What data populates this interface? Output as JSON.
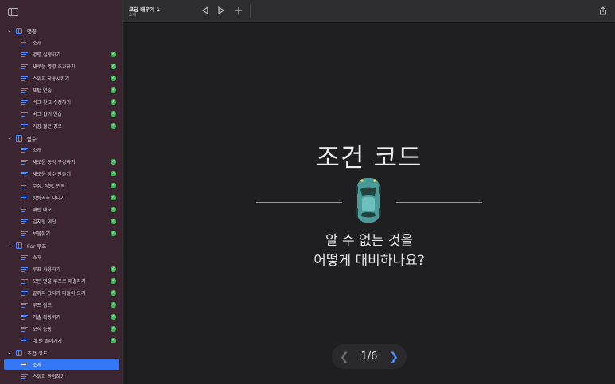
{
  "window": {
    "title": "코딩 배우기 1",
    "subtitle": "소개"
  },
  "toolbar": {
    "buttons": [
      {
        "name": "back-button",
        "icon": "triangle-left-icon"
      },
      {
        "name": "play-button",
        "icon": "triangle-right-icon"
      },
      {
        "name": "add-button",
        "icon": "plus-icon"
      },
      {
        "name": "share-button",
        "icon": "share-icon"
      }
    ]
  },
  "sidebar": {
    "chapters": [
      {
        "title": "명령",
        "pages": [
          {
            "label": "소개",
            "done": false
          },
          {
            "label": "명령 실행하기",
            "done": true
          },
          {
            "label": "새로운 명령 추가하기",
            "done": true
          },
          {
            "label": "스위치 작동시키기",
            "done": true
          },
          {
            "label": "포털 연습",
            "done": true
          },
          {
            "label": "버그 찾고 수정하기",
            "done": true
          },
          {
            "label": "버그 잡기 연습",
            "done": true
          },
          {
            "label": "가장 짧은 경로",
            "done": true
          }
        ]
      },
      {
        "title": "함수",
        "pages": [
          {
            "label": "소개",
            "done": false
          },
          {
            "label": "새로운 동작 구성하기",
            "done": true
          },
          {
            "label": "새로운 함수 만들기",
            "done": true
          },
          {
            "label": "수집, 작동, 반복",
            "done": true
          },
          {
            "label": "방방곡곡 다니기",
            "done": true
          },
          {
            "label": "패턴 내포",
            "done": true
          },
          {
            "label": "일지형 계단",
            "done": true
          },
          {
            "label": "보물찾기",
            "done": true
          }
        ]
      },
      {
        "title": "For 루프",
        "pages": [
          {
            "label": "소개",
            "done": false
          },
          {
            "label": "루프 사용하기",
            "done": true
          },
          {
            "label": "모든 면을 루프로 해결하기",
            "done": true
          },
          {
            "label": "끝까지 갔다가 되돌아 오기",
            "done": true
          },
          {
            "label": "루프 점프",
            "done": true
          },
          {
            "label": "기술 확장하기",
            "done": true
          },
          {
            "label": "보석 농장",
            "done": true
          },
          {
            "label": "네 번 돌아가기",
            "done": true
          }
        ]
      },
      {
        "title": "조건 코드",
        "pages": [
          {
            "label": "소개",
            "done": false,
            "selected": true
          },
          {
            "label": "스위치 확인하기",
            "done": false
          }
        ]
      }
    ]
  },
  "content": {
    "heading": "조건 코드",
    "question_line1": "알 수 없는 것을",
    "question_line2": "어떻게 대비하나요?",
    "illustration": "car-topdown-icon"
  },
  "pager": {
    "current": 1,
    "total": 6,
    "label": "1/6"
  },
  "colors": {
    "sidebar_bg": "#3a2530",
    "accent": "#3478f6",
    "done": "#3fba5a",
    "car_body": "#4a9a98"
  }
}
